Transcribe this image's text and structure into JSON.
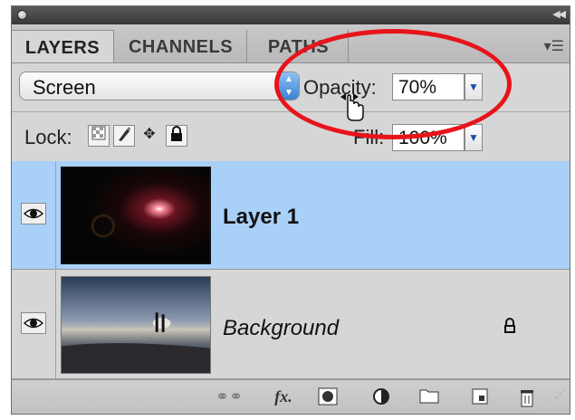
{
  "tabs": [
    {
      "label": "LAYERS",
      "active": true
    },
    {
      "label": "CHANNELS",
      "active": false
    },
    {
      "label": "PATHS",
      "active": false
    }
  ],
  "blend_mode": {
    "value": "Screen"
  },
  "opacity": {
    "label": "Opacity:",
    "value": "70%"
  },
  "lock": {
    "label": "Lock:"
  },
  "fill": {
    "label": "Fill:",
    "value": "100%"
  },
  "layers": [
    {
      "name": "Layer 1",
      "selected": true,
      "visible": true,
      "locked": false,
      "italic": false
    },
    {
      "name": "Background",
      "selected": false,
      "visible": true,
      "locked": true,
      "italic": true
    }
  ],
  "colors": {
    "selection": "#a9d1f8",
    "annotation": "#e8141b",
    "panel": "#d6d6d6"
  },
  "icons": {
    "lock_buttons": [
      "lock-transparent-pixels-icon",
      "lock-image-pixels-icon",
      "lock-position-icon",
      "lock-all-icon"
    ],
    "footer": [
      "link-layers-icon",
      "layer-style-fx-icon",
      "layer-mask-icon",
      "adjustment-layer-icon",
      "new-group-icon",
      "new-layer-icon",
      "trash-icon"
    ]
  }
}
